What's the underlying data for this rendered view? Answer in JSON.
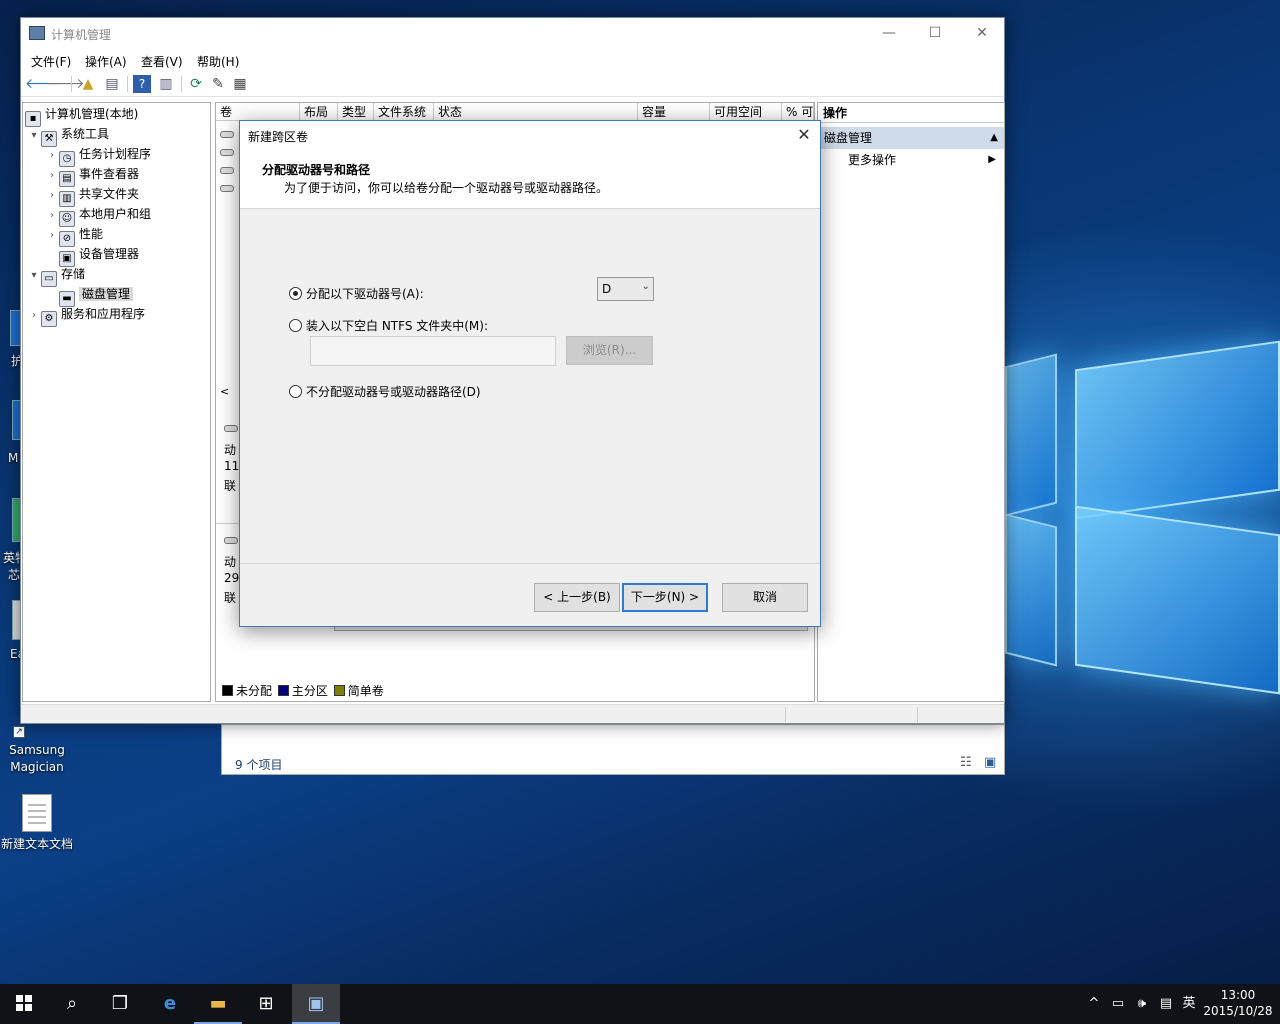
{
  "main_window": {
    "title": "计算机管理",
    "controls": {
      "minimize": "—",
      "maximize": "☐",
      "close": "✕"
    },
    "menu": [
      "文件(F)",
      "操作(A)",
      "查看(V)",
      "帮助(H)"
    ],
    "tree": {
      "root": "计算机管理(本地)",
      "system_tools": "系统工具",
      "task_scheduler": "任务计划程序",
      "event_viewer": "事件查看器",
      "shared_folders": "共享文件夹",
      "local_users": "本地用户和组",
      "performance": "性能",
      "device_manager": "设备管理器",
      "storage": "存储",
      "disk_management": "磁盘管理",
      "services_apps": "服务和应用程序"
    },
    "columns": [
      "卷",
      "布局",
      "类型",
      "文件系统",
      "状态",
      "容量",
      "可用空间",
      "% 可"
    ],
    "disk_fragments": {
      "d1_line1": "动",
      "d1_line2": "11",
      "d1_line3": "联",
      "d2_line1": "动",
      "d2_line2": "29",
      "d2_line3": "联",
      "scroll_left": "<"
    },
    "legend": {
      "unallocated": "未分配",
      "primary": "主分区",
      "simple": "简单卷"
    },
    "actions": {
      "header": "操作",
      "section": "磁盘管理",
      "more": "更多操作"
    }
  },
  "explorer_behind": {
    "item_count": "9 个项目"
  },
  "wizard": {
    "title": "新建跨区卷",
    "heading": "分配驱动器号和路径",
    "subheading": "为了便于访问，你可以给卷分配一个驱动器号或驱动器路径。",
    "option_assign": "分配以下驱动器号(A):",
    "option_mount": "装入以下空白 NTFS 文件夹中(M):",
    "option_none": "不分配驱动器号或驱动器路径(D)",
    "drive_letter": "D",
    "browse_label": "浏览(R)...",
    "back_label": "< 上一步(B)",
    "next_label": "下一步(N) >",
    "cancel_label": "取消",
    "selected_option": "assign"
  },
  "desktop": {
    "icons": [
      {
        "label": "Samsung Magician"
      },
      {
        "label": "新建文本文档"
      }
    ],
    "edge_fragments": {
      "a": "护",
      "b": "M",
      "c": "英特",
      "d": "芯",
      "e": "Ea"
    }
  },
  "taskbar": {
    "tray": {
      "chevron": "^",
      "lang": "英"
    },
    "time": "13:00",
    "date": "2015/10/28"
  },
  "colors": {
    "legend_unallocated": "#000000",
    "legend_primary": "#000080",
    "legend_simple": "#808000",
    "accent": "#2d7ad6"
  }
}
